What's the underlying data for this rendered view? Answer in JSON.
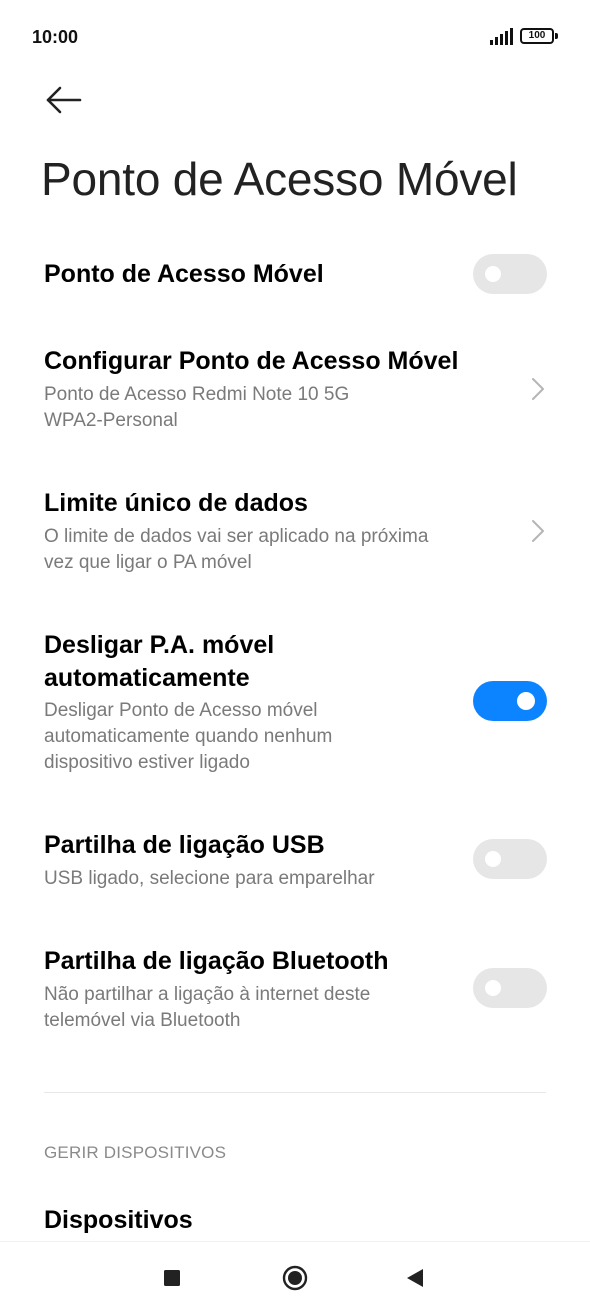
{
  "status_bar": {
    "time": "10:00",
    "battery": "100",
    "icons": [
      "signal-icon",
      "battery-icon"
    ]
  },
  "header": {
    "back_icon": "arrow-left-icon",
    "title": "Ponto de Acesso Móvel"
  },
  "settings": [
    {
      "title": "Ponto de Acesso Móvel",
      "subtitle": "",
      "control": "toggle",
      "state": "off"
    },
    {
      "title": "Configurar Ponto de Acesso Móvel",
      "subtitle_lines": [
        "Ponto de Acesso Redmi Note 10 5G",
        "WPA2-Personal"
      ],
      "control": "chevron"
    },
    {
      "title": "Limite único de dados",
      "subtitle_lines": [
        "O limite de dados vai ser aplicado na próxima",
        "vez que ligar o PA móvel"
      ],
      "control": "chevron"
    },
    {
      "title_lines": [
        "Desligar P.A. móvel",
        "automaticamente"
      ],
      "subtitle_lines": [
        "Desligar Ponto de Acesso móvel",
        "automaticamente quando nenhum",
        "dispositivo estiver ligado"
      ],
      "control": "toggle",
      "state": "on"
    },
    {
      "title": "Partilha de ligação USB",
      "subtitle": "USB ligado, selecione para emparelhar",
      "control": "toggle",
      "state": "off"
    },
    {
      "title": "Partilha de ligação Bluetooth",
      "subtitle_lines": [
        "Não partilhar a ligação à internet deste",
        "telemóvel via Bluetooth"
      ],
      "control": "toggle",
      "state": "off"
    }
  ],
  "section": {
    "label": "GERIR DISPOSITIVOS"
  },
  "devices": {
    "title": "Dispositivos"
  },
  "colors": {
    "accent": "#0d84ff",
    "toggle_off": "#e6e6e6",
    "subtitle": "#7a7a7a"
  },
  "nav_bar": {
    "icons": [
      "recents-square-icon",
      "home-circle-icon",
      "back-triangle-icon"
    ]
  }
}
